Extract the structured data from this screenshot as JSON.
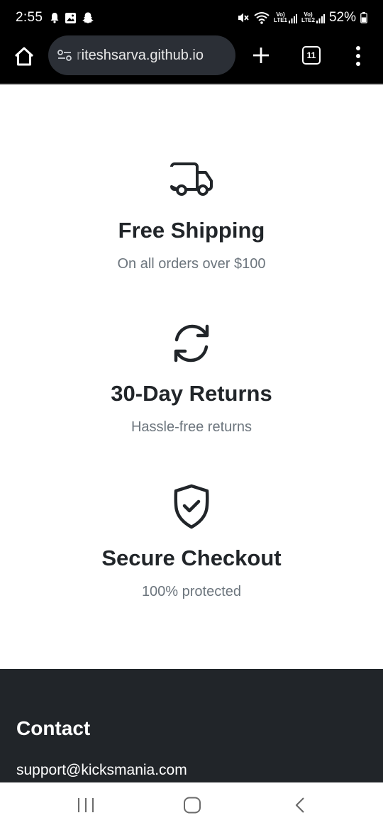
{
  "status_bar": {
    "time": "2:55",
    "left_icons": [
      "bell-icon",
      "image-icon",
      "snapchat-icon"
    ],
    "right_icons": [
      "mute-icon",
      "wifi-icon",
      "signal-lte1-icon",
      "signal-lte2-icon",
      "battery-icon"
    ],
    "lte1_label_top": "Vo)",
    "lte1_label_bottom": "LTE1",
    "lte2_label_top": "Vo)",
    "lte2_label_bottom": "LTE2",
    "battery": "52%"
  },
  "browser": {
    "url_prefix": "r",
    "url": "iteshsarva.github.io",
    "tab_count": "11"
  },
  "features": [
    {
      "icon": "truck-icon",
      "title": "Free Shipping",
      "description": "On all orders over $100"
    },
    {
      "icon": "refresh-icon",
      "title": "30-Day Returns",
      "description": "Hassle-free returns"
    },
    {
      "icon": "shield-check-icon",
      "title": "Secure Checkout",
      "description": "100% protected"
    }
  ],
  "footer": {
    "title": "Contact",
    "email": "support@kicksmania.com"
  },
  "colors": {
    "title_text": "#212529",
    "muted_text": "#6c757d",
    "footer_bg": "#212529",
    "toolbar_bg": "#000000",
    "url_bar_bg": "#2b2f36"
  }
}
